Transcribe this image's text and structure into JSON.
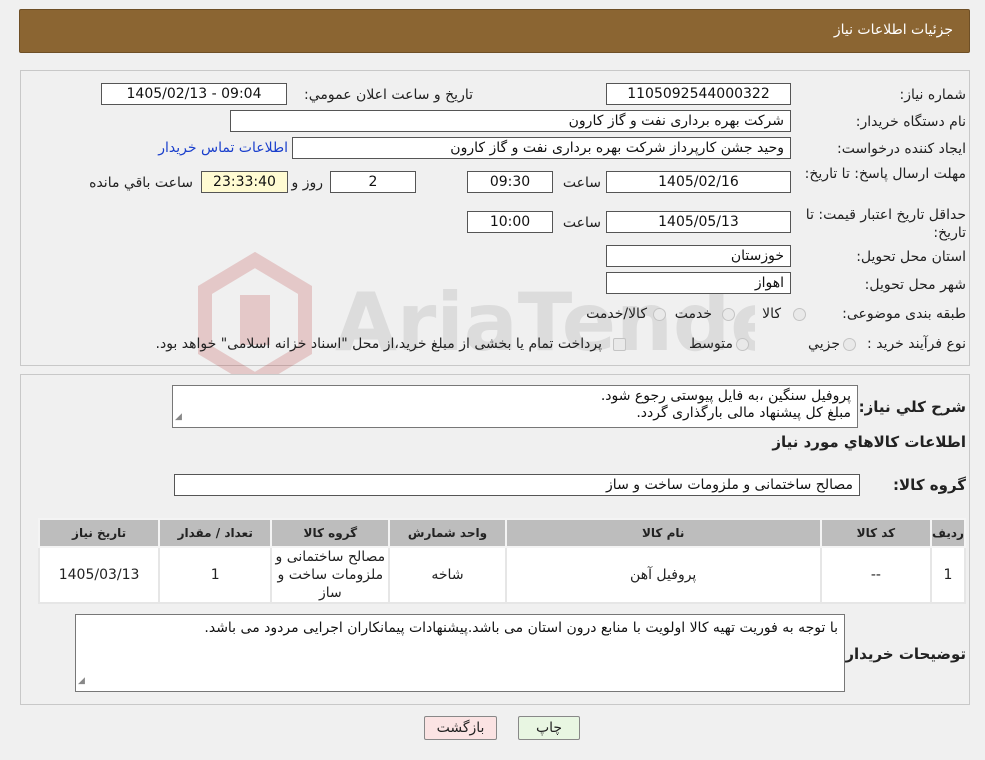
{
  "header": {
    "title": "جزئیات اطلاعات نیاز"
  },
  "form": {
    "need_number": {
      "label": "شماره نیاز:",
      "value": "1105092544000322"
    },
    "announce_datetime": {
      "label": "تاریخ و ساعت اعلان عمومي:",
      "value": "1405/02/13 - 09:04"
    },
    "buyer_org": {
      "label": "نام دستگاه خریدار:",
      "value": "شرکت بهره برداری نفت و گاز کارون"
    },
    "requester": {
      "label": "ایجاد کننده درخواست:",
      "value": "وحید جشن کارپرداز شرکت بهره برداری نفت و گاز کارون",
      "contact_link": "اطلاعات تماس خریدار"
    },
    "reply_deadline": {
      "label": "مهلت ارسال پاسخ: تا تاریخ:",
      "date": "1405/02/16",
      "time_label": "ساعت",
      "time": "09:30",
      "days": "2",
      "days_label": "روز و",
      "remaining": "23:33:40",
      "remaining_label": "ساعت باقي مانده"
    },
    "price_validity": {
      "label": "حداقل تاریخ اعتبار قیمت: تا تاریخ:",
      "date": "1405/05/13",
      "time_label": "ساعت",
      "time": "10:00"
    },
    "province": {
      "label": "استان محل تحویل:",
      "value": "خوزستان"
    },
    "city": {
      "label": "شهر محل تحویل:",
      "value": "اهواز"
    },
    "category": {
      "label": "طبقه بندی موضوعی:",
      "options": [
        "کالا",
        "خدمت",
        "کالا/خدمت"
      ]
    },
    "process": {
      "label": "نوع فرآیند خرید :",
      "options": [
        "جزيي",
        "متوسط"
      ],
      "note": "پرداخت تمام یا بخشی از مبلغ خرید،از محل \"اسناد خزانه اسلامی\" خواهد بود."
    }
  },
  "description": {
    "label": "شرح کلي نياز:",
    "line1": "پروفیل سنگین ،به فایل پیوستی رجوع شود.",
    "line2": "مبلغ کل پیشنهاد مالی بارگذاری گردد."
  },
  "goods_section": {
    "title": "اطلاعات کالاهاي مورد نياز",
    "group_label": "گروه کالا:",
    "group_value": "مصالح ساختمانی و ملزومات ساخت و ساز"
  },
  "table": {
    "headers": [
      "رديف",
      "کد کالا",
      "نام کالا",
      "واحد شمارش",
      "گروه کالا",
      "تعداد / مقدار",
      "تاریخ نیاز"
    ],
    "rows": [
      {
        "row": "1",
        "code": "--",
        "name": "پروفیل آهن",
        "unit": "شاخه",
        "group": "مصالح ساختمانی و ملزومات ساخت و ساز",
        "qty": "1",
        "date": "1405/03/13"
      }
    ]
  },
  "buyer_notes": {
    "label": "توضیحات خریدار:",
    "value": "با توجه به فوریت تهیه کالا اولویت با منابع درون استان می باشد.پیشنهادات پیمانکاران اجرایی مردود می باشد."
  },
  "buttons": {
    "print": "چاپ",
    "back": "بازگشت"
  },
  "colors": {
    "header_bg": "#8b6532",
    "back_btn_bg": "#fbe3e3",
    "print_btn_bg": "#e8f6e2",
    "link": "#1a3fcc"
  }
}
